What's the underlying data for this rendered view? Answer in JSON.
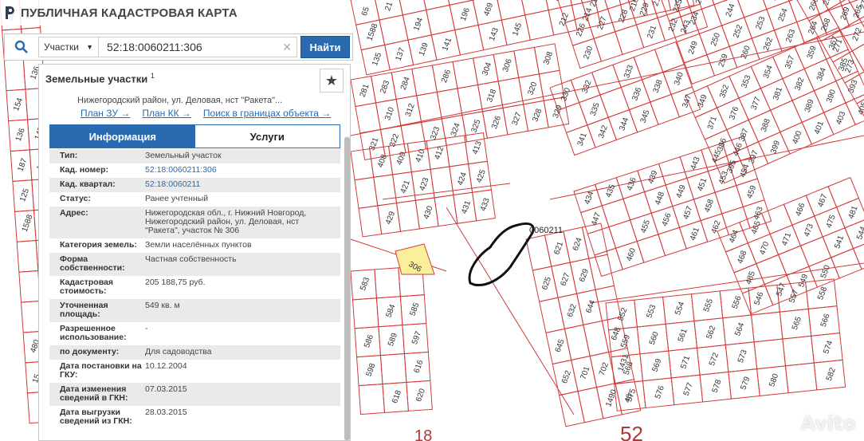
{
  "header": {
    "title": "ПУБЛИЧНАЯ КАДАСТРОВАЯ КАРТА"
  },
  "search": {
    "type": "Участки",
    "value": "52:18:0060211:306",
    "button": "Найти"
  },
  "panel": {
    "title": "Земельные участки",
    "title_sup": "1",
    "addr_line": "Нижегородский район, ул. Деловая, нст \"Ракета\"...",
    "links": [
      "План ЗУ →",
      "План КК →",
      "Поиск в границах объекта →"
    ],
    "tabs": [
      "Информация",
      "Услуги"
    ],
    "rows": [
      {
        "label": "Тип:",
        "value": "Земельный участок"
      },
      {
        "label": "Кад. номер:",
        "value": "52:18:0060211:306",
        "link": true
      },
      {
        "label": "Кад. квартал:",
        "value": "52:18:0060211",
        "link": true
      },
      {
        "label": "Статус:",
        "value": "Ранее учтенный"
      },
      {
        "label": "Адрес:",
        "value": "Нижегородская обл., г. Нижний Новгород, Нижегородский район, ул. Деловая, нст \"Ракета\", участок № 306"
      },
      {
        "label": "Категория земель:",
        "value": "Земли населённых пунктов"
      },
      {
        "label": "Форма собственности:",
        "value": "Частная собственность"
      },
      {
        "label": "Кадастровая стоимость:",
        "value": "205 188,75 руб."
      },
      {
        "label": "Уточненная площадь:",
        "value": "549 кв. м"
      },
      {
        "label": "Разрешенное использование:",
        "value": "-"
      },
      {
        "label": "по документу:",
        "value": "Для садоводства"
      },
      {
        "label": "Дата постановки на ГКУ:",
        "value": "10.12.2004"
      },
      {
        "label": "Дата изменения сведений в ГКН:",
        "value": "07.03.2015"
      },
      {
        "label": "Дата выгрузки сведений из ГКН:",
        "value": "28.03.2015"
      }
    ]
  },
  "map": {
    "quarter_label": "0060211",
    "parcels": [
      "65",
      "21",
      "91",
      "136",
      "154",
      "136",
      "147",
      "187",
      "123",
      "125",
      "1588",
      "194",
      "196",
      "469",
      "480",
      "184",
      "15",
      "133",
      "135",
      "137",
      "139",
      "141",
      "143",
      "145",
      "212",
      "214",
      "216",
      "218",
      "220",
      "222",
      "223",
      "224",
      "226",
      "227",
      "228",
      "229",
      "230",
      "231",
      "232",
      "234",
      "235",
      "236",
      "237",
      "238",
      "239",
      "240",
      "241",
      "242",
      "243",
      "244",
      "245",
      "246",
      "247",
      "248",
      "249",
      "250",
      "252",
      "253",
      "254",
      "256",
      "258",
      "259",
      "260",
      "262",
      "263",
      "264",
      "265",
      "266",
      "267",
      "268",
      "269",
      "270",
      "271",
      "272",
      "273",
      "274",
      "275",
      "276",
      "277",
      "278",
      "279",
      "280",
      "281",
      "283",
      "284",
      "286",
      "304",
      "306",
      "308",
      "310",
      "312",
      "318",
      "320",
      "321",
      "322",
      "323",
      "324",
      "325",
      "326",
      "327",
      "328",
      "329",
      "330",
      "332",
      "333",
      "335",
      "336",
      "338",
      "340",
      "341",
      "342",
      "344",
      "345",
      "347",
      "349",
      "352",
      "353",
      "354",
      "357",
      "359",
      "367",
      "371",
      "376",
      "377",
      "381",
      "382",
      "384",
      "385",
      "386",
      "387",
      "388",
      "389",
      "390",
      "393",
      "395",
      "397",
      "399",
      "400",
      "401",
      "403",
      "405",
      "408",
      "409",
      "410",
      "412",
      "413",
      "421",
      "423",
      "424",
      "425",
      "429",
      "430",
      "431",
      "433",
      "434",
      "435",
      "436",
      "439",
      "443",
      "445",
      "446",
      "447",
      "448",
      "449",
      "451",
      "453",
      "454",
      "455",
      "456",
      "457",
      "458",
      "459",
      "460",
      "461",
      "462",
      "463",
      "464",
      "465",
      "466",
      "467",
      "468",
      "470",
      "471",
      "473",
      "475",
      "481",
      "485",
      "541",
      "544",
      "546",
      "547",
      "549",
      "550",
      "551",
      "552",
      "553",
      "554",
      "555",
      "556",
      "557",
      "558",
      "559",
      "560",
      "561",
      "562",
      "564",
      "565",
      "566",
      "568",
      "569",
      "571",
      "572",
      "573",
      "574",
      "575",
      "576",
      "577",
      "578",
      "579",
      "580",
      "582",
      "583",
      "584",
      "585",
      "586",
      "589",
      "597",
      "598",
      "616",
      "618",
      "620",
      "621",
      "624",
      "625",
      "627",
      "629",
      "632",
      "644",
      "645",
      "648",
      "652",
      "701",
      "702",
      "1431",
      "1490",
      "46",
      "52"
    ],
    "bottom_labels": [
      "18",
      "52"
    ]
  },
  "watermark": "Avito"
}
